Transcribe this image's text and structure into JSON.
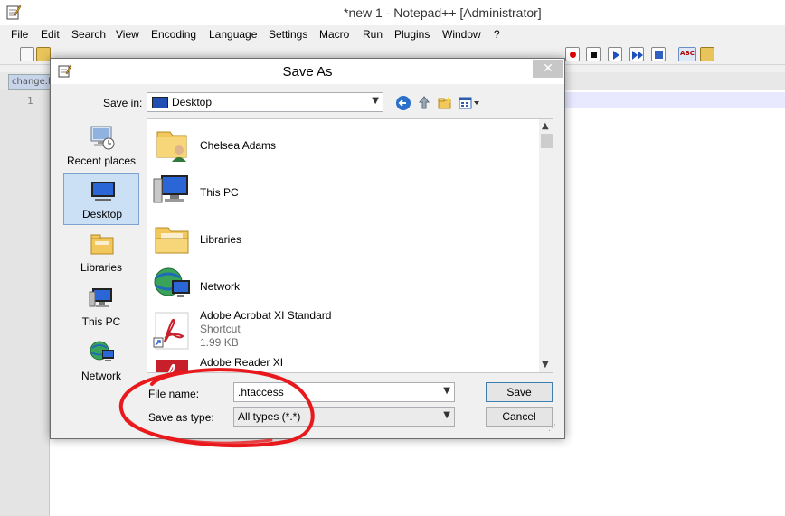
{
  "window": {
    "title": "*new  1 - Notepad++ [Administrator]"
  },
  "menu": [
    "File",
    "Edit",
    "Search",
    "View",
    "Encoding",
    "Language",
    "Settings",
    "Macro",
    "Run",
    "Plugins",
    "Window",
    "?"
  ],
  "tab": {
    "label": "change.log"
  },
  "editor": {
    "line_number": "1"
  },
  "dialog": {
    "title": "Save As",
    "close_glyph": "✕",
    "save_in_label": "Save in:",
    "save_in_value": "Desktop",
    "places": [
      {
        "label": "Recent places",
        "icon": "recent-places-icon"
      },
      {
        "label": "Desktop",
        "icon": "desktop-icon",
        "selected": true
      },
      {
        "label": "Libraries",
        "icon": "libraries-icon"
      },
      {
        "label": "This PC",
        "icon": "this-pc-icon"
      },
      {
        "label": "Network",
        "icon": "network-icon"
      }
    ],
    "files": [
      {
        "name": "Chelsea Adams",
        "icon": "user-folder-icon"
      },
      {
        "name": "This PC",
        "icon": "this-pc-icon"
      },
      {
        "name": "Libraries",
        "icon": "libraries-icon"
      },
      {
        "name": "Network",
        "icon": "network-icon"
      },
      {
        "name": "Adobe Acrobat XI Standard",
        "type": "Shortcut",
        "size": "1.99 KB",
        "icon": "acrobat-shortcut-icon"
      },
      {
        "name": "Adobe Reader XI",
        "icon": "reader-shortcut-icon"
      }
    ],
    "file_name_label": "File name:",
    "file_name_value": ".htaccess",
    "save_as_type_label": "Save as type:",
    "save_as_type_value": "All types (*.*)",
    "save_button": "Save",
    "cancel_button": "Cancel"
  },
  "colors": {
    "annotation": "#e8191d",
    "selected_place": "#cce0f5",
    "current_line": "#e8e8ff"
  }
}
